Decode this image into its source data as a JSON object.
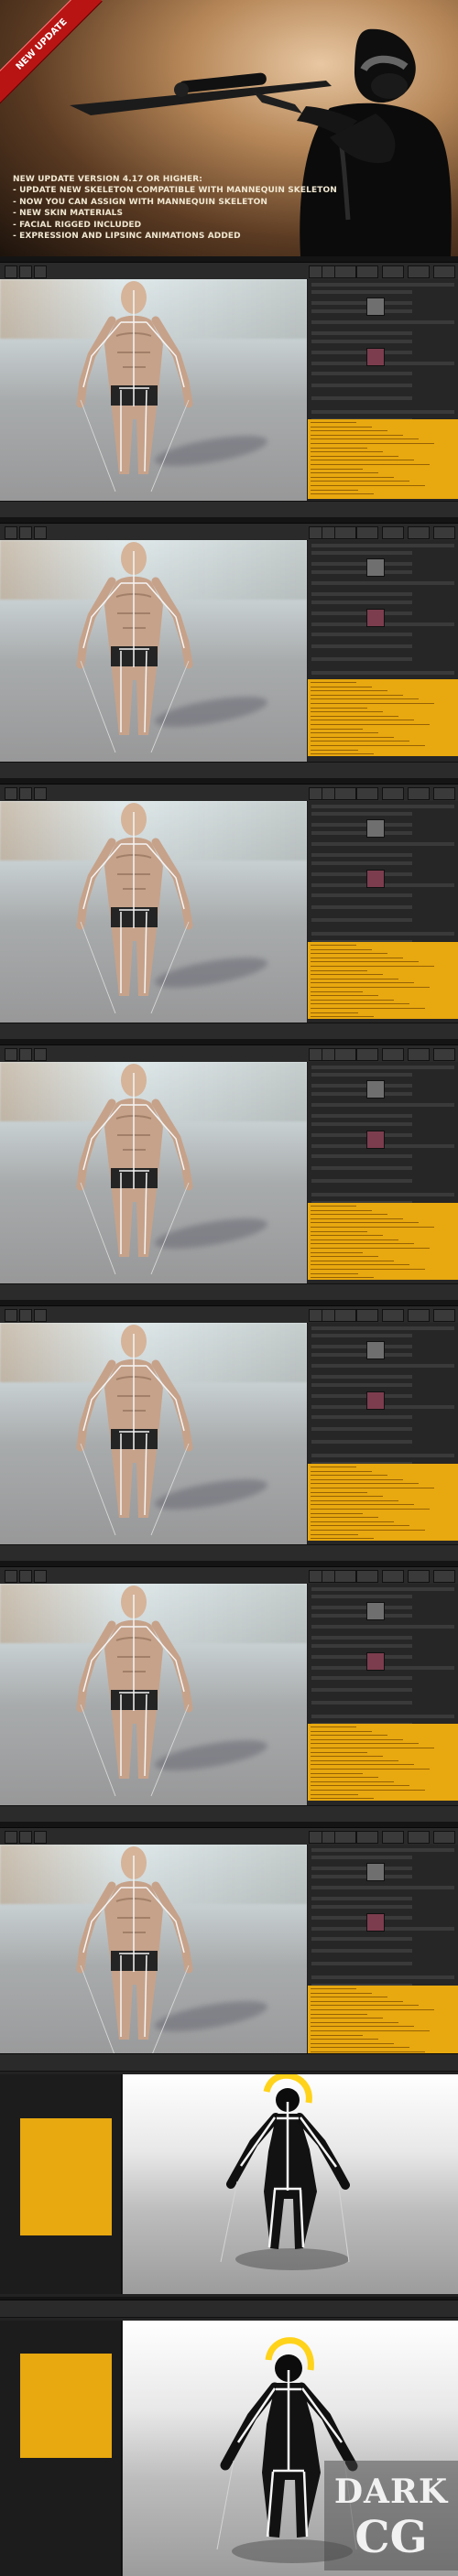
{
  "banner": {
    "ribbon_text": "NEW UPDATE",
    "lines": [
      "New update version 4.17 or higher:",
      "- update new skeleton compatible with mannequin skeleton",
      "- Now you can assign with mannequin skeleton",
      "- New skin materials",
      "- Facial rigged included",
      "- Expression and lipsinc animations added"
    ]
  },
  "watermark": {
    "line1": "DARK",
    "line2": "CG"
  },
  "colors": {
    "accent": "#e8a80f",
    "banner_red": "#b81414"
  }
}
